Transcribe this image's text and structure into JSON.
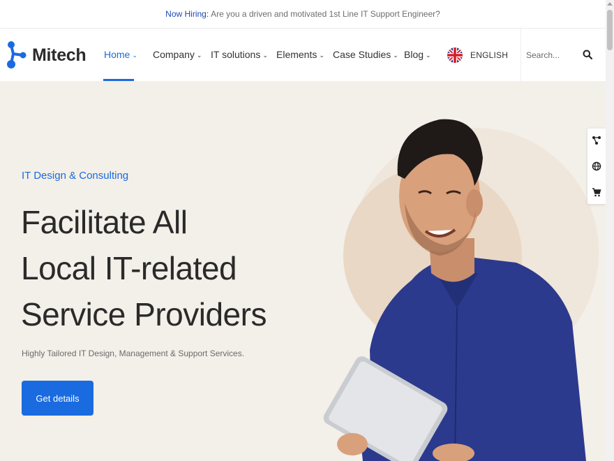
{
  "topbar": {
    "highlight": "Now Hiring:",
    "message": "Are you a driven and motivated 1st Line IT Support Engineer?"
  },
  "brand": {
    "name": "Mitech",
    "logo_icon": "molecule-logo-icon",
    "color": "#1a6be0"
  },
  "nav": {
    "items": [
      {
        "label": "Home",
        "active": true
      },
      {
        "label": "Company",
        "active": false
      },
      {
        "label": "IT solutions",
        "active": false
      },
      {
        "label": "Elements",
        "active": false
      },
      {
        "label": "Case Studies",
        "active": false
      },
      {
        "label": "Blog",
        "active": false
      }
    ],
    "chevron": "⌄"
  },
  "language": {
    "label": "ENGLISH",
    "flag_icon": "uk-flag-icon"
  },
  "search": {
    "placeholder": "Search...",
    "icon": "search-icon"
  },
  "hero": {
    "eyebrow": "IT Design & Consulting",
    "headline": [
      "Facilitate All",
      "Local IT-related",
      "Service Providers"
    ],
    "subtitle": "Highly Tailored IT Design, Management & Support Services.",
    "cta_label": "Get details",
    "background": "#f3efe9",
    "accent": "#1a6be0"
  },
  "side_widget": {
    "icons": [
      "share-icon",
      "globe-icon",
      "cart-icon"
    ]
  }
}
